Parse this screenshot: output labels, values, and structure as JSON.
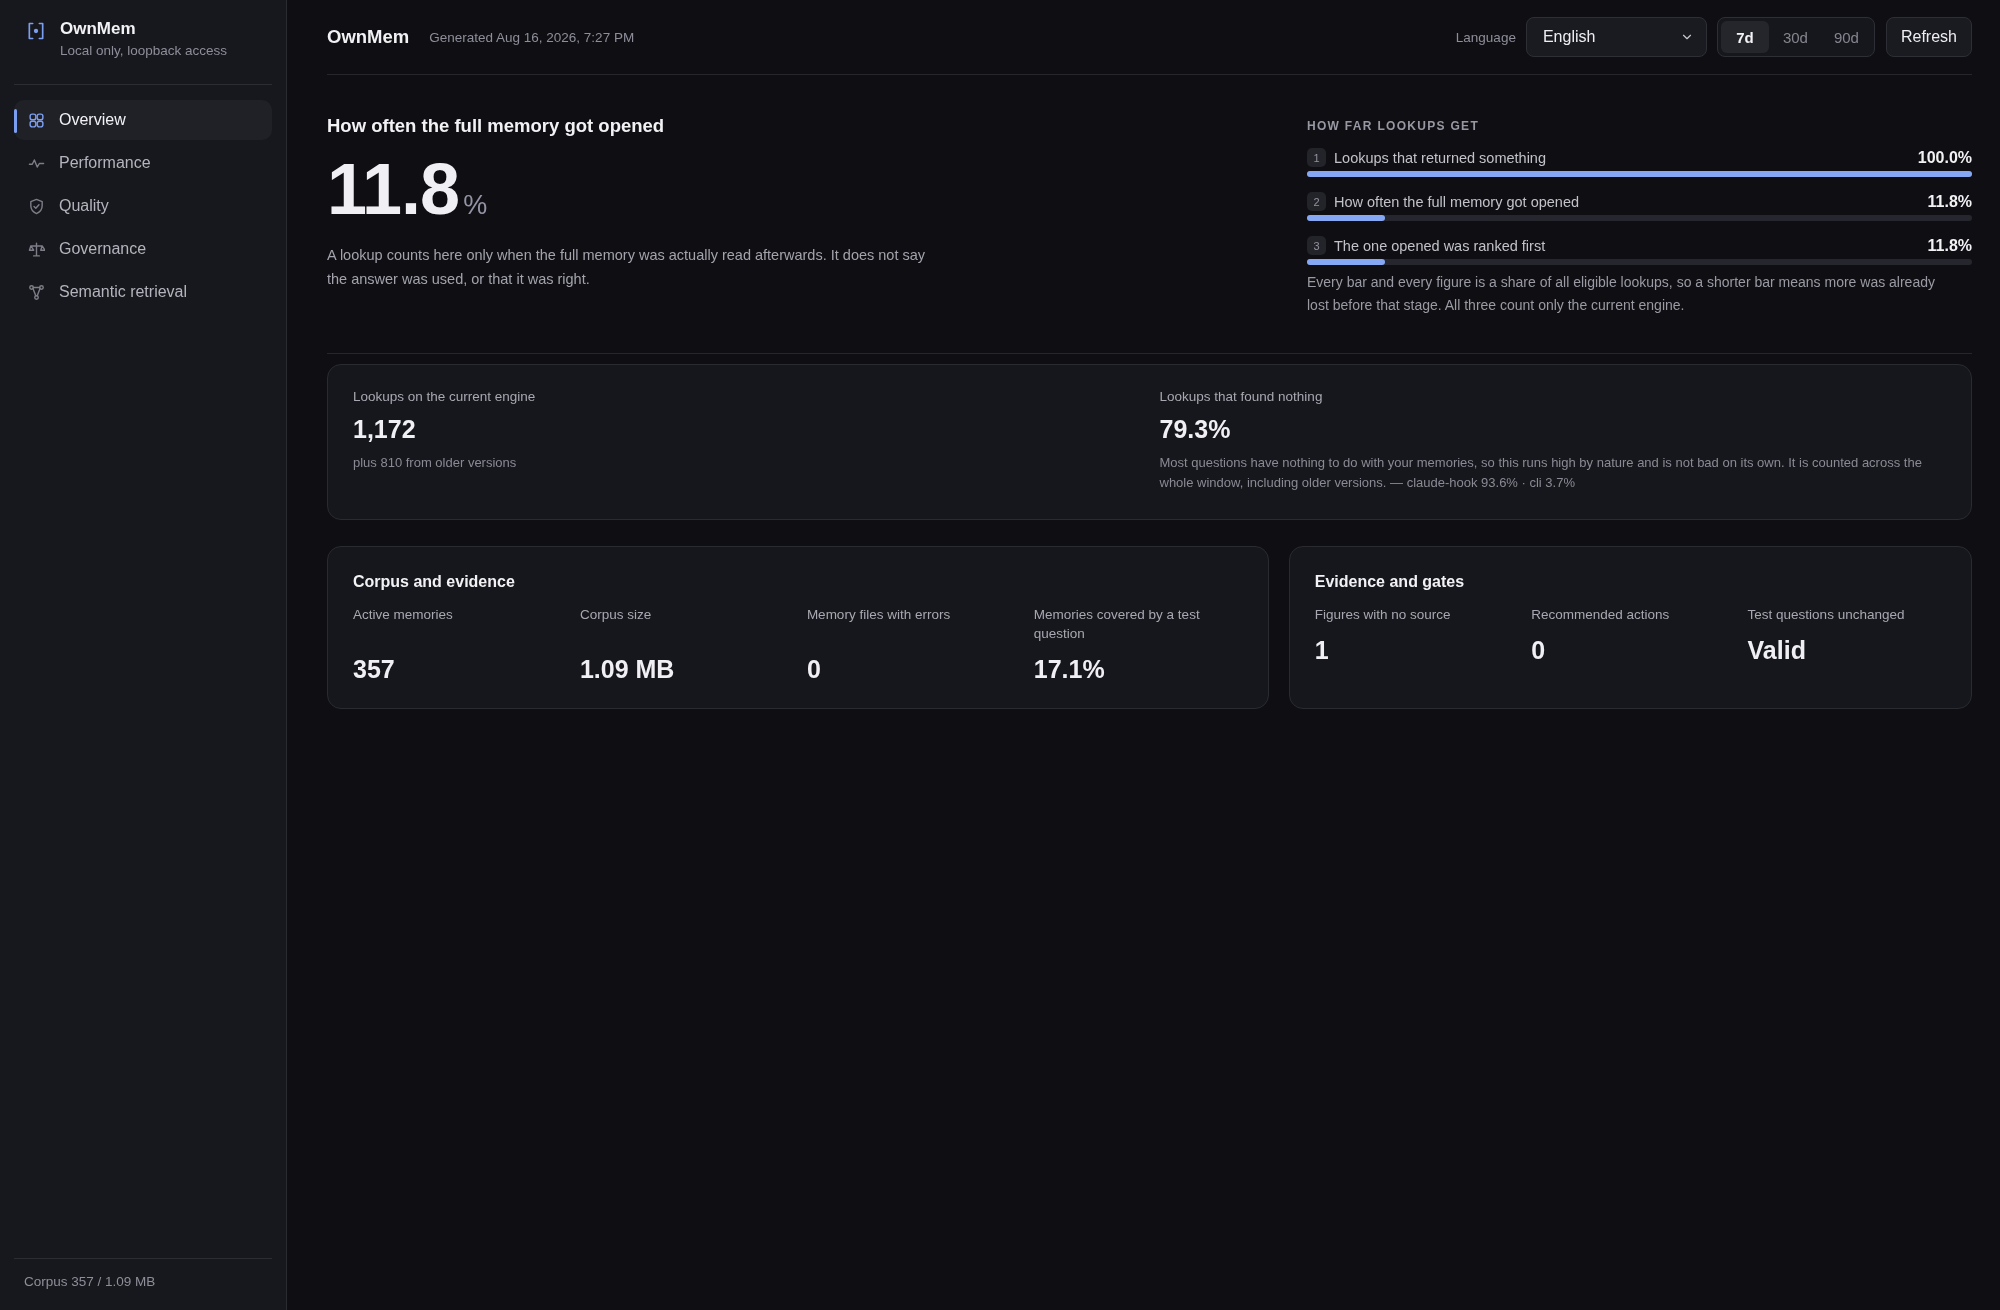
{
  "sidebar": {
    "brand": "OwnMem",
    "subtitle": "Local only, loopback access",
    "items": [
      {
        "label": "Overview",
        "selected": true
      },
      {
        "label": "Performance",
        "selected": false
      },
      {
        "label": "Quality",
        "selected": false
      },
      {
        "label": "Governance",
        "selected": false
      },
      {
        "label": "Semantic retrieval",
        "selected": false
      }
    ],
    "footer": "Corpus 357 / 1.09 MB"
  },
  "header": {
    "title": "OwnMem",
    "generated": "Generated Aug 16, 2026, 7:27 PM",
    "language_label": "Language",
    "language": "English",
    "ranges": [
      {
        "label": "7d",
        "selected": true
      },
      {
        "label": "30d",
        "selected": false
      },
      {
        "label": "90d",
        "selected": false
      }
    ],
    "refresh": "Refresh"
  },
  "hero": {
    "title": "How often the full memory got opened",
    "value": "11.8",
    "unit": "%",
    "description": "A lookup counts here only when the full memory was actually read afterwards. It does not say the answer was used, or that it was right."
  },
  "funnel": {
    "title": "HOW FAR LOOKUPS GET",
    "steps": [
      {
        "index": "1",
        "label": "Lookups that returned something",
        "reading": "100.0%",
        "level": 1.0
      },
      {
        "index": "2",
        "label": "How often the full memory got opened",
        "reading": "11.8%",
        "level": 0.118
      },
      {
        "index": "3",
        "label": "The one opened was ranked first",
        "reading": "11.8%",
        "level": 0.118
      }
    ],
    "note": "Every bar and every figure is a share of all eligible lookups, so a shorter bar means more was already lost before that stage. All three count only the current engine."
  },
  "summary": [
    {
      "label": "Lookups on the current engine",
      "value": "1,172",
      "note": "plus 810 from older versions"
    },
    {
      "label": "Lookups that found nothing",
      "value": "79.3%",
      "note": "Most questions have nothing to do with your memories, so this runs high by nature and is not bad on its own. It is counted across the whole window, including older versions. — claude-hook 93.6% · cli 3.7%"
    }
  ],
  "sections": [
    {
      "title": "Corpus and evidence",
      "metrics": [
        {
          "label": "Active memories",
          "value": "357"
        },
        {
          "label": "Corpus size",
          "value": "1.09 MB"
        },
        {
          "label": "Memory files with errors",
          "value": "0"
        },
        {
          "label": "Memories covered by a test question",
          "value": "17.1%"
        }
      ]
    },
    {
      "title": "Evidence and gates",
      "metrics": [
        {
          "label": "Figures with no source",
          "value": "1"
        },
        {
          "label": "Recommended actions",
          "value": "0"
        },
        {
          "label": "Test questions unchanged",
          "value": "Valid"
        }
      ]
    }
  ]
}
